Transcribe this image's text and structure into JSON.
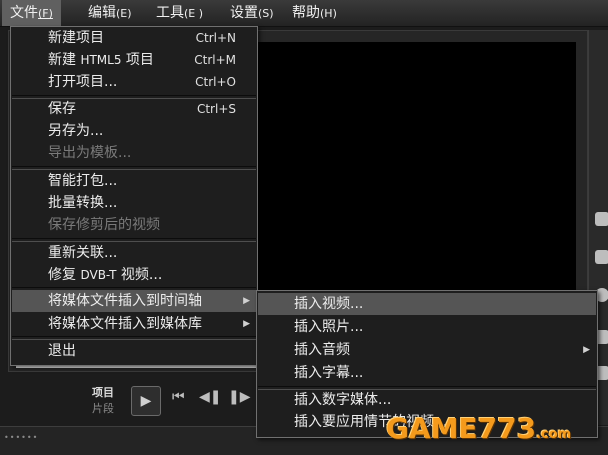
{
  "menubar": {
    "items": [
      {
        "label": "文件",
        "accel": "(F)"
      },
      {
        "label": "编辑",
        "accel": "(E)"
      },
      {
        "label": "工具",
        "accel": "(E )"
      },
      {
        "label": "设置",
        "accel": "(S)"
      },
      {
        "label": "帮助",
        "accel": "(H)"
      }
    ]
  },
  "file_menu": {
    "items": [
      {
        "label": "新建项目",
        "shortcut": "Ctrl+N"
      },
      {
        "label_a": "新建 ",
        "label_b": "HTML5",
        "label_c": " 项目",
        "shortcut": "Ctrl+M"
      },
      {
        "label": "打开项目...",
        "shortcut": "Ctrl+O"
      },
      {
        "label": "保存",
        "shortcut": "Ctrl+S"
      },
      {
        "label": "另存为..."
      },
      {
        "label": "导出为模板...",
        "disabled": true
      },
      {
        "label": "智能打包..."
      },
      {
        "label": "批量转换..."
      },
      {
        "label": "保存修剪后的视频",
        "disabled": true
      },
      {
        "label": "重新关联..."
      },
      {
        "label_a": "修复 ",
        "label_b": "DVB-T",
        "label_c": " 视频..."
      },
      {
        "label": "将媒体文件插入到时间轴",
        "submenu": true,
        "highlighted": true
      },
      {
        "label": "将媒体文件插入到媒体库",
        "submenu": true
      },
      {
        "label": "退出"
      }
    ]
  },
  "insert_submenu": {
    "items": [
      {
        "label": "插入视频...",
        "highlighted": true
      },
      {
        "label": "插入照片..."
      },
      {
        "label": "插入音频",
        "submenu": true
      },
      {
        "label": "插入字幕..."
      },
      {
        "label": "插入数字媒体..."
      },
      {
        "label": "插入要应用情节的视频..."
      }
    ]
  },
  "player": {
    "project_label": "项目",
    "clip_label": "片段"
  },
  "watermark": {
    "text": "GAME773",
    "domain": ".com"
  },
  "colors": {
    "menu_bg": "#1e1e1e",
    "highlight": "#555555",
    "disabled_text": "#7a7a7a",
    "watermark": "#f49a1c"
  }
}
